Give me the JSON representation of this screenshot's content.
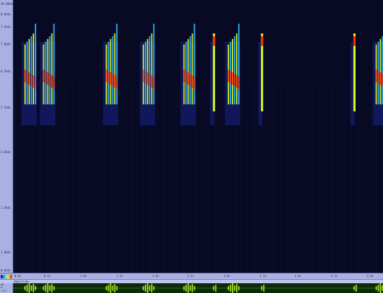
{
  "spectrogram": {
    "y_axis_labels": [
      "48.00kHz",
      "8.0kHz",
      "7.5kHz",
      "7.0kHz",
      "6.5kHz",
      "5.5kHz",
      "4.0kHz",
      "2.5kHz",
      "1.0kHz",
      "0.0kHz"
    ],
    "x_axis_labels": [
      "0.0s",
      "0.5s",
      "1.0s",
      "1.5s",
      "2.0s",
      "2.5s",
      "3.0s",
      "3.5s",
      "4.0s",
      "4.5s",
      "5.0s"
    ],
    "colors": {
      "background": "#080a24",
      "low": "#2030c0",
      "mid": "#30c0ff",
      "high": "#e0ff20",
      "peak": "#ff3000"
    }
  },
  "waveform": {
    "track_label": "Amplitude",
    "y_axis_labels": [
      "dB",
      "0",
      "-inf"
    ],
    "color": "#9ad020"
  },
  "bursts": [
    {
      "x": 0.03,
      "type": "chirp"
    },
    {
      "x": 0.08,
      "type": "chirp"
    },
    {
      "x": 0.25,
      "type": "chirp"
    },
    {
      "x": 0.35,
      "type": "chirp"
    },
    {
      "x": 0.46,
      "type": "chirp"
    },
    {
      "x": 0.54,
      "type": "single"
    },
    {
      "x": 0.58,
      "type": "chirp"
    },
    {
      "x": 0.67,
      "type": "single"
    },
    {
      "x": 0.92,
      "type": "single"
    },
    {
      "x": 0.98,
      "type": "chirp"
    }
  ]
}
